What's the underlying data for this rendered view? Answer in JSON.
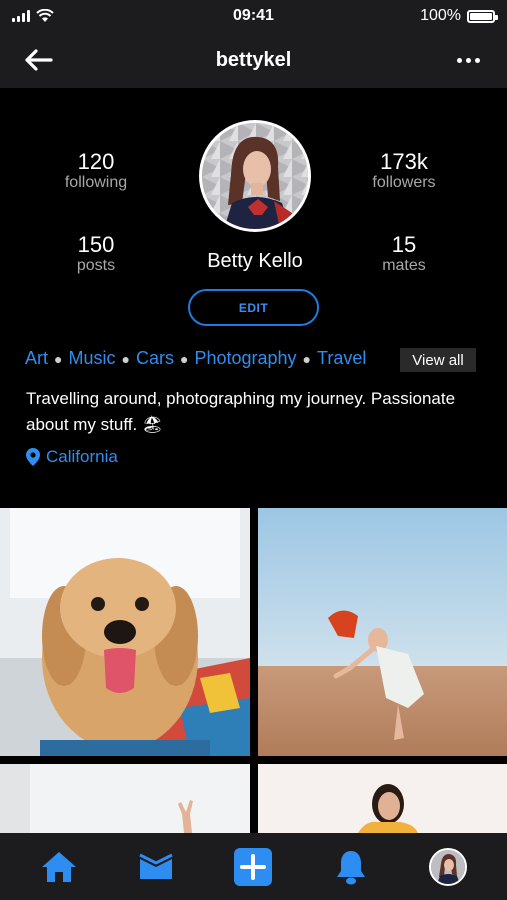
{
  "status_bar": {
    "time": "09:41",
    "battery": "100%",
    "icons": [
      "signal-icon",
      "wifi-icon",
      "battery-icon"
    ]
  },
  "nav": {
    "title": "bettykel",
    "back_icon": "arrow-left-icon",
    "more_icon": "more-dots-icon"
  },
  "profile": {
    "following_count": "120",
    "following_label": "following",
    "followers_count": "173k",
    "followers_label": "followers",
    "posts_count": "150",
    "posts_label": "posts",
    "mates_count": "15",
    "mates_label": "mates",
    "name": "Betty Kello",
    "edit_label": "EDIT"
  },
  "interests": {
    "tags": [
      "Art",
      "Music",
      "Cars",
      "Photography",
      "Travel"
    ],
    "view_all_label": "View all"
  },
  "bio": {
    "text": "Travelling around, photographing my journey. Passionate about my stuff. 🏖"
  },
  "location": {
    "icon": "location-pin-icon",
    "text": "California"
  },
  "tab_bar": {
    "items": [
      "home-icon",
      "inbox-icon",
      "add-icon",
      "bell-icon",
      "profile-avatar"
    ]
  },
  "colors": {
    "accent": "#2f8ef0",
    "bar_background": "#1c1c1e",
    "background": "#000000",
    "muted_text": "#a8a8a8"
  }
}
